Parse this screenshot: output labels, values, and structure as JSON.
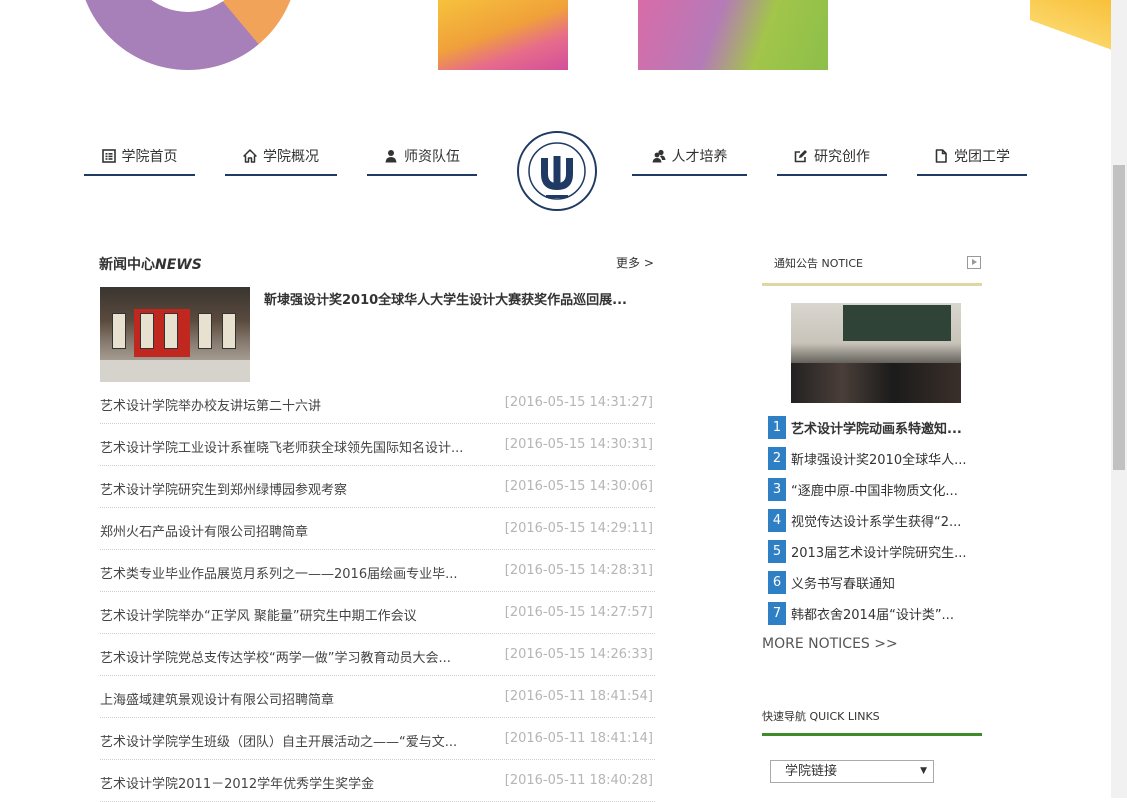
{
  "nav": {
    "items": [
      {
        "label": "学院首页",
        "icon": "list-icon"
      },
      {
        "label": "学院概况",
        "icon": "home-icon"
      },
      {
        "label": "师资队伍",
        "icon": "user-icon"
      },
      {
        "label": "人才培养",
        "icon": "users-icon"
      },
      {
        "label": "研究创作",
        "icon": "edit-icon"
      },
      {
        "label": "党团工学",
        "icon": "file-icon"
      }
    ],
    "logo_alt": "ZHENGZHOU INSTITUTE OF LIGHT INDUSTRY"
  },
  "news": {
    "heading_cn": "新闻中心",
    "heading_en": "NEWS",
    "more": "更多 >",
    "feature_title": "靳埭强设计奖2010全球华人大学生设计大赛获奖作品巡回展...",
    "rows": [
      {
        "title": "艺术设计学院举办校友讲坛第二十六讲",
        "date": "[2016-05-15 14:31:27]"
      },
      {
        "title": "艺术设计学院工业设计系崔晓飞老师获全球领先国际知名设计...",
        "date": "[2016-05-15 14:30:31]"
      },
      {
        "title": "艺术设计学院研究生到郑州绿博园参观考察",
        "date": "[2016-05-15 14:30:06]"
      },
      {
        "title": "郑州火石产品设计有限公司招聘简章",
        "date": "[2016-05-15 14:29:11]"
      },
      {
        "title": "艺术类专业毕业作品展览月系列之一——2016届绘画专业毕...",
        "date": "[2016-05-15 14:28:31]"
      },
      {
        "title": "艺术设计学院举办“正学风 聚能量”研究生中期工作会议",
        "date": "[2016-05-15 14:27:57]"
      },
      {
        "title": "艺术设计学院党总支传达学校“两学一做”学习教育动员大会...",
        "date": "[2016-05-15 14:26:33]"
      },
      {
        "title": "上海盛域建筑景观设计有限公司招聘简章",
        "date": "[2016-05-11 18:41:54]"
      },
      {
        "title": "艺术设计学院学生班级（团队）自主开展活动之——“爱与文...",
        "date": "[2016-05-11 18:41:14]"
      },
      {
        "title": "艺术设计学院2011－2012学年优秀学生奖学金",
        "date": "[2016-05-11 18:40:28]"
      }
    ]
  },
  "notice": {
    "heading": "通知公告 NOTICE",
    "items": [
      {
        "num": "1",
        "text": "艺术设计学院动画系特邀知..."
      },
      {
        "num": "2",
        "text": "靳埭强设计奖2010全球华人..."
      },
      {
        "num": "3",
        "text": "“逐鹿中原-中国非物质文化..."
      },
      {
        "num": "4",
        "text": "视觉传达设计系学生获得“2..."
      },
      {
        "num": "5",
        "text": "2013届艺术设计学院研究生..."
      },
      {
        "num": "6",
        "text": "义务书写春联通知"
      },
      {
        "num": "7",
        "text": "韩都衣舍2014届“设计类”..."
      }
    ],
    "more": "MORE NOTICES >>"
  },
  "quick_links": {
    "heading": "快速导航 QUICK LINKS",
    "select_value": "学院链接"
  },
  "colors": {
    "nav_underline": "#1f3a63",
    "notice_number_bg": "#2f7fc4",
    "notice_bar": "#e0d6a2",
    "quick_links_bar": "#3f8a2a",
    "date_text": "#b5b5b5"
  }
}
